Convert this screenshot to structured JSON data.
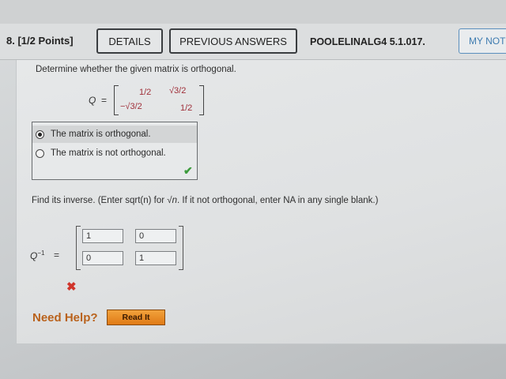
{
  "header": {
    "question_label": "8. [1/2 Points]",
    "details_label": "DETAILS",
    "previous_answers_label": "PREVIOUS ANSWERS",
    "problem_code": "POOLELINALG4 5.1.017.",
    "my_notes_label": "MY NOT"
  },
  "question": {
    "prompt": "Determine whether the given matrix is orthogonal.",
    "matrix_label": "Q",
    "matrix_equals": "=",
    "matrix": {
      "r0c0": "1/2",
      "r0c1": "√3/2",
      "r1c0": "−√3/2",
      "r1c1": "1/2"
    },
    "choices": [
      {
        "label": "The matrix is orthogonal.",
        "selected": true
      },
      {
        "label": "The matrix is not orthogonal.",
        "selected": false
      }
    ],
    "choice_result": "correct"
  },
  "inverse": {
    "prompt_before": "Find its inverse. (Enter sqrt(n) for ",
    "prompt_sqrt": "√n",
    "prompt_after": ". If it not orthogonal, enter NA in any single blank.)",
    "label": "Q",
    "label_exp": "−1",
    "equals": "=",
    "entries": {
      "r0c0": "1",
      "r0c1": "0",
      "r1c0": "0",
      "r1c1": "1"
    },
    "result": "incorrect"
  },
  "help": {
    "need_help_label": "Need Help?",
    "read_it_label": "Read It"
  },
  "colors": {
    "correct": "#3c9b3c",
    "incorrect": "#d0352b",
    "matrix_text": "#a0303a",
    "notes_link": "#3d7bb0",
    "help_text": "#b9621c"
  }
}
